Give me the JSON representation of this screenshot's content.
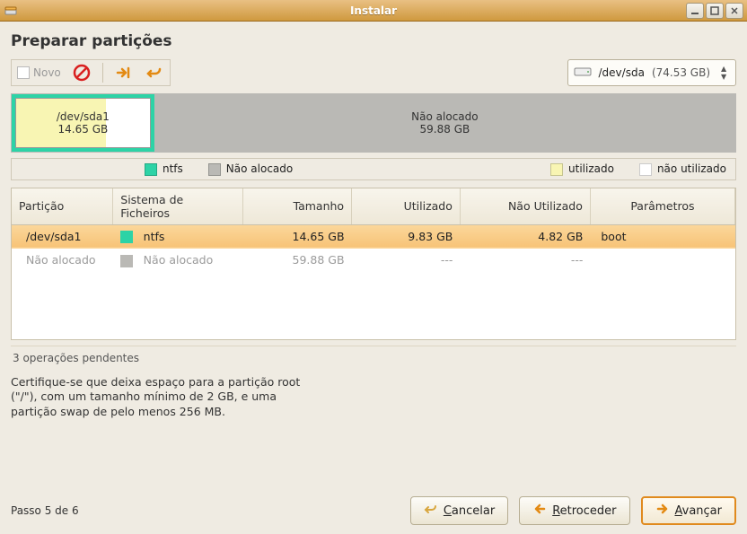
{
  "window": {
    "title": "Instalar"
  },
  "page": {
    "heading": "Preparar partições"
  },
  "toolbar": {
    "novo_label": "Novo"
  },
  "device": {
    "path": "/dev/sda",
    "size": "(74.53 GB)"
  },
  "graph": {
    "sda1": {
      "label": "/dev/sda1",
      "size": "14.65 GB"
    },
    "unallocated": {
      "label": "Não alocado",
      "size": "59.88 GB"
    }
  },
  "legend": {
    "ntfs": "ntfs",
    "unallocated": "Não alocado",
    "used": "utilizado",
    "unused": "não utilizado"
  },
  "table": {
    "headers": {
      "partition": "Partição",
      "filesystem": "Sistema de Ficheiros",
      "size": "Tamanho",
      "used": "Utilizado",
      "unused": "Não Utilizado",
      "params": "Parâmetros"
    },
    "rows": [
      {
        "partition": "/dev/sda1",
        "fs_color": "#2dd3a6",
        "filesystem": "ntfs",
        "size": "14.65 GB",
        "used": "9.83 GB",
        "unused": "4.82 GB",
        "params": "boot",
        "state": "selected"
      },
      {
        "partition": "Não alocado",
        "fs_color": "#bab9b5",
        "filesystem": "Não alocado",
        "size": "59.88 GB",
        "used": "---",
        "unused": "---",
        "params": "",
        "state": "dim"
      }
    ]
  },
  "pending": "3 operações pendentes",
  "advice": {
    "l1": "Certifique-se que deixa espaço para a partição root",
    "l2": "(\"/\"), com um tamanho mínimo de 2 GB, e uma",
    "l3": "partição swap de pelo menos 256 MB."
  },
  "footer": {
    "step": "Passo 5 de 6",
    "cancel": "Cancelar",
    "back": "Retroceder",
    "forward": "Avançar"
  }
}
